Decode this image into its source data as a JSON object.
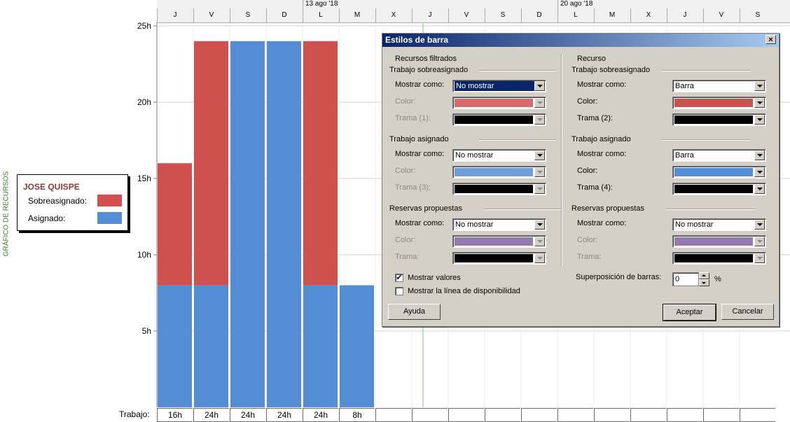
{
  "timescale": {
    "weeks": [
      "13 ago '18",
      "20 ago '18"
    ],
    "days": [
      "J",
      "V",
      "S",
      "D",
      "L",
      "M",
      "X",
      "J",
      "V",
      "S",
      "D",
      "L",
      "M",
      "X",
      "J",
      "V",
      "S"
    ]
  },
  "chart_data": {
    "type": "bar",
    "categories": [
      "J",
      "V",
      "S",
      "D",
      "L",
      "M"
    ],
    "series": [
      {
        "name": "Asignado",
        "values": [
          8,
          8,
          24,
          24,
          8,
          8
        ],
        "color": "#548dd4"
      },
      {
        "name": "Sobreasignado",
        "values": [
          8,
          16,
          0,
          0,
          16,
          0
        ],
        "color": "#d05050"
      }
    ],
    "yticks": [
      "5h",
      "10h",
      "15h",
      "20h",
      "25h"
    ],
    "ylim": [
      0,
      25
    ],
    "ylabel": "GRÁFICO DE RECURSOS",
    "stacked": true,
    "grid": true
  },
  "legend": {
    "resource_name": "JOSE QUISPE",
    "items": [
      {
        "label": "Sobreasignado:",
        "color": "#d05050"
      },
      {
        "label": "Asignado:",
        "color": "#548dd4"
      }
    ]
  },
  "work_row": {
    "label": "Trabajo:",
    "values": [
      "16h",
      "24h",
      "24h",
      "24h",
      "24h",
      "8h"
    ]
  },
  "dialog": {
    "title": "Estilos de barra",
    "close_label": "×",
    "left": {
      "heading": "Recursos filtrados",
      "sections": [
        {
          "title": "Trabajo sobreasignado",
          "show_label": "Mostrar como:",
          "show_value": "No mostrar",
          "color_label": "Color:",
          "color": "#d05050",
          "pattern_label": "Trama (1):"
        },
        {
          "title": "Trabajo asignado",
          "show_label": "Mostrar como:",
          "show_value": "No mostrar",
          "color_label": "Color:",
          "color": "#548dd4",
          "pattern_label": "Trama (3):"
        },
        {
          "title": "Reservas propuestas",
          "show_label": "Mostrar como:",
          "show_value": "No mostrar",
          "color_label": "Color:",
          "color": "#8064a2",
          "pattern_label": "Trama:"
        }
      ]
    },
    "right": {
      "heading": "Recurso",
      "sections": [
        {
          "title": "Trabajo sobreasignado",
          "show_label": "Mostrar como:",
          "show_value": "Barra",
          "color_label": "Color:",
          "color": "#d05050",
          "pattern_label": "Trama (2):"
        },
        {
          "title": "Trabajo asignado",
          "show_label": "Mostrar como:",
          "show_value": "Barra",
          "color_label": "Color:",
          "color": "#548dd4",
          "pattern_label": "Trama (4):"
        },
        {
          "title": "Reservas propuestas",
          "show_label": "Mostrar como:",
          "show_value": "No mostrar",
          "color_label": "Color:",
          "color": "#8064a2",
          "pattern_label": "Trama:"
        }
      ]
    },
    "show_values_label": "Mostrar valores",
    "show_availability_label": "Mostrar la línea de disponibilidad",
    "overlap_label": "Superposición de barras:",
    "overlap_value": "0",
    "overlap_unit": "%",
    "help_label": "Ayuda",
    "ok_label": "Aceptar",
    "cancel_label": "Cancelar"
  }
}
